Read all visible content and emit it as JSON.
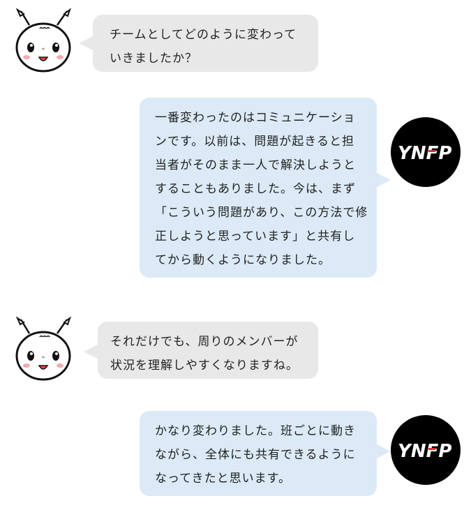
{
  "messages": [
    {
      "speaker": "interviewer",
      "lines": [
        "チームとしてどのように変わって",
        "いきましたか？"
      ]
    },
    {
      "speaker": "ynfp",
      "logo_text": "YNFP",
      "lines": [
        "一番変わったのはコミュニケーショ",
        "ンです。以前は、問題が起きると担",
        "当者がそのまま一人で解決しようと",
        "することもありました。今は、まず",
        "「こういう問題があり、この方法で修",
        "正しようと思っています」と共有し",
        "てから動くようになりました。"
      ]
    },
    {
      "speaker": "interviewer",
      "lines": [
        "それだけでも、周りのメンバーが",
        "状況を理解しやすくなりますね。"
      ]
    },
    {
      "speaker": "ynfp",
      "logo_text": "YNFP",
      "lines": [
        "かなり変わりました。班ごとに動き",
        "ながら、全体にも共有できるように",
        "なってきたと思います。"
      ]
    }
  ],
  "colors": {
    "interviewer_bubble": "#e8e8e8",
    "ynfp_bubble": "#dbeaf6",
    "logo_bg": "#000000",
    "logo_accent": "#e5322d"
  }
}
